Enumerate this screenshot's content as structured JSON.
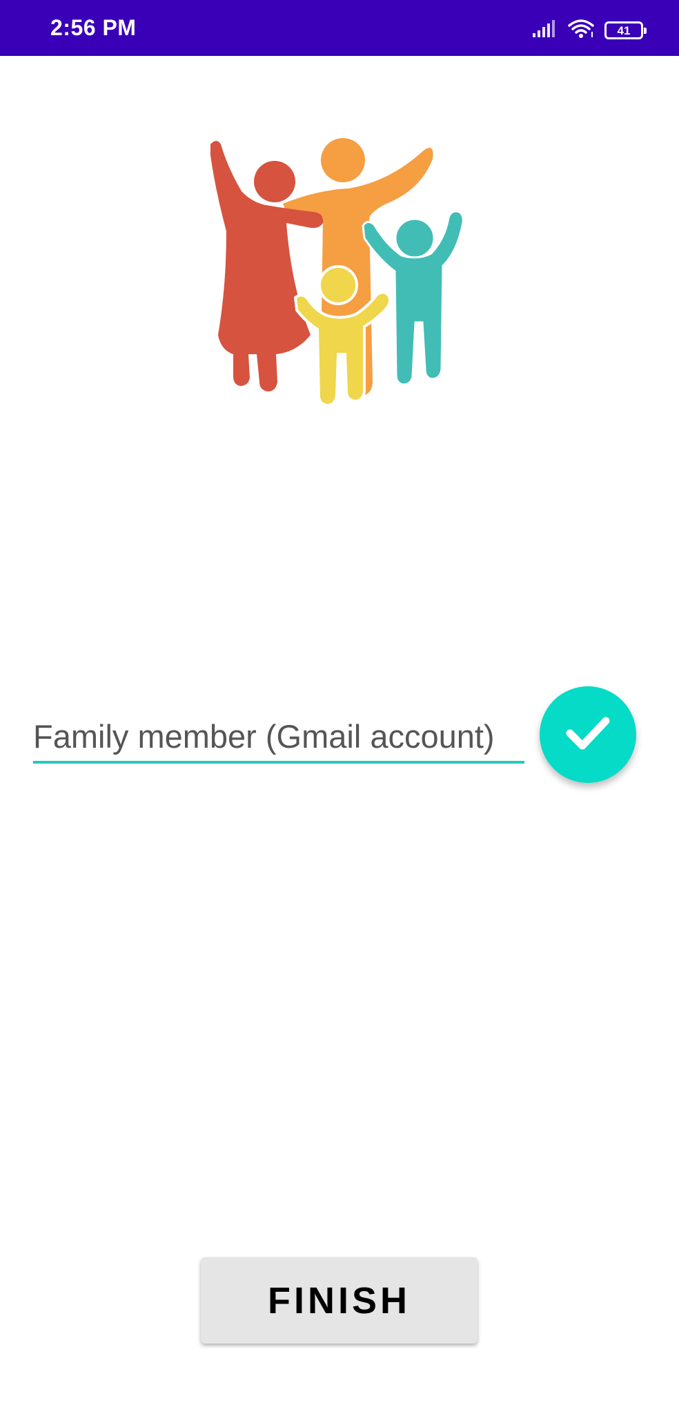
{
  "status_bar": {
    "time": "2:56 PM",
    "battery_level": "41",
    "signal_icon": "cellular-signal-icon",
    "wifi_icon": "wifi-icon",
    "battery_icon": "battery-icon",
    "background_color": "#3a00b8"
  },
  "logo": {
    "icon": "family-logo-icon",
    "colors": [
      "#d6533f",
      "#f59e42",
      "#41bdb6",
      "#efd64a"
    ]
  },
  "member_input": {
    "placeholder": "Family member (Gmail account)",
    "value": "",
    "underline_color": "#24c8bd"
  },
  "confirm_button": {
    "icon": "checkmark-icon",
    "color": "#05dbc6"
  },
  "finish_button": {
    "label": "FINISH"
  }
}
